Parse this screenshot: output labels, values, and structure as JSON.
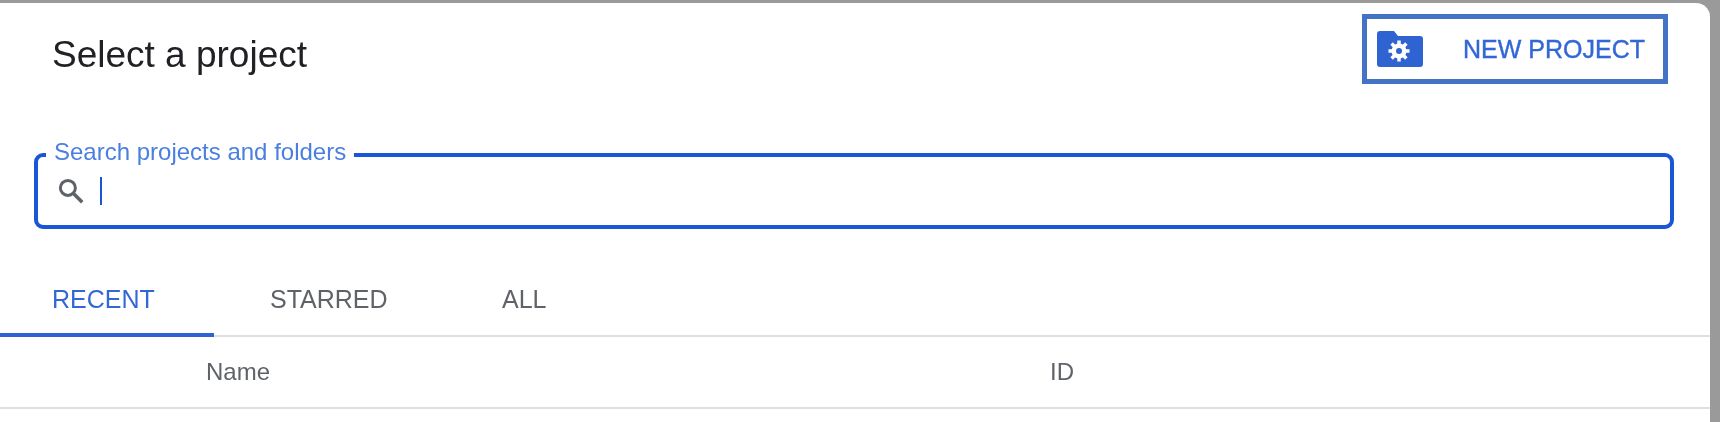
{
  "dialog": {
    "title": "Select a project"
  },
  "new_project_button": {
    "label": "NEW PROJECT"
  },
  "search": {
    "label": "Search projects and folders",
    "focused": true
  },
  "tabs": [
    {
      "label": "RECENT",
      "selected": true
    },
    {
      "label": "STARRED",
      "selected": false
    },
    {
      "label": "ALL",
      "selected": false
    }
  ],
  "table": {
    "columns": [
      "Name",
      "ID"
    ]
  }
}
